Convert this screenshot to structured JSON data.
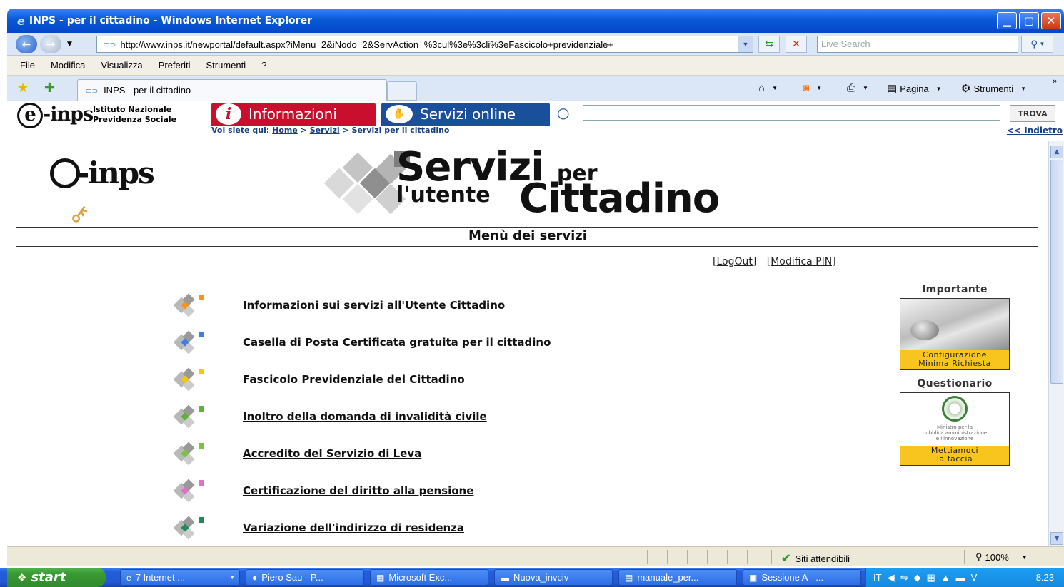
{
  "window": {
    "title": "INPS - per il cittadino - Windows Internet Explorer",
    "minimize_icon": "minimize-icon",
    "maximize_icon": "maximize-icon",
    "close_icon": "close-icon"
  },
  "addressbar": {
    "url": "http://www.inps.it/newportal/default.aspx?iMenu=2&iNodo=2&ServAction=%3cul%3e%3cli%3eFascicolo+previdenziale+",
    "search_placeholder": "Live Search"
  },
  "menubar": [
    "File",
    "Modifica",
    "Visualizza",
    "Preferiti",
    "Strumenti",
    "?"
  ],
  "tabbar": {
    "tab_title": "INPS - per il cittadino",
    "commands": {
      "pagina": "Pagina",
      "strumenti": "Strumenti"
    }
  },
  "site_header": {
    "brand": "inps",
    "institute_line1": "Istituto Nazionale",
    "institute_line2": "Previdenza Sociale",
    "tab_informazioni": "Informazioni",
    "tab_servizi": "Servizi online",
    "trova_label": "TROVA",
    "breadcrumb_label": "Voi siete qui:",
    "breadcrumb": [
      "Home",
      "Servizi",
      "Servizi per il cittadino"
    ],
    "back_link": "<< Indietro"
  },
  "banner": {
    "logo_text": "inps",
    "title_word1": "Servizi",
    "title_word2": "per",
    "title_word3": "l'utente",
    "title_word4": "Cittadino"
  },
  "menu_title": "Menù dei servizi",
  "account": {
    "logout": "[LogOut]",
    "modifica_pin": "[Modifica PIN]"
  },
  "services": [
    {
      "label": "Informazioni sui servizi all'Utente Cittadino",
      "accent": "#f7941d"
    },
    {
      "label": "Casella di Posta Certificata gratuita per il cittadino",
      "accent": "#3b7ee8"
    },
    {
      "label": "Fascicolo Previdenziale del Cittadino",
      "accent": "#f2c811"
    },
    {
      "label": "Inoltro della domanda di invalidità civile",
      "accent": "#5fb236"
    },
    {
      "label": "Accredito del Servizio di Leva",
      "accent": "#7cc242"
    },
    {
      "label": "Certificazione del diritto alla pensione",
      "accent": "#e070c8"
    },
    {
      "label": "Variazione dell'indirizzo di residenza",
      "accent": "#1f8a5a"
    }
  ],
  "sidebar": {
    "importante_title": "Importante",
    "importante_caption_l1": "Configurazione",
    "importante_caption_l2": "Minima Richiesta",
    "questionario_title": "Questionario",
    "questionario_caption_l1": "Mettiamoci",
    "questionario_caption_l2": "la faccia",
    "emblem_text_l1": "Ministro per la",
    "emblem_text_l2": "pubblica amministrazione",
    "emblem_text_l3": "e l'innovazione"
  },
  "statusbar": {
    "zone": "Siti attendibili",
    "zoom": "100%"
  },
  "taskbar": {
    "start": "start",
    "tasks": [
      "7 Internet ...",
      "Piero Sau - P...",
      "Microsoft Exc...",
      "Nuova_invciv",
      "manuale_per...",
      "Sessione A - ..."
    ],
    "lang": "IT",
    "clock": "8.23"
  }
}
